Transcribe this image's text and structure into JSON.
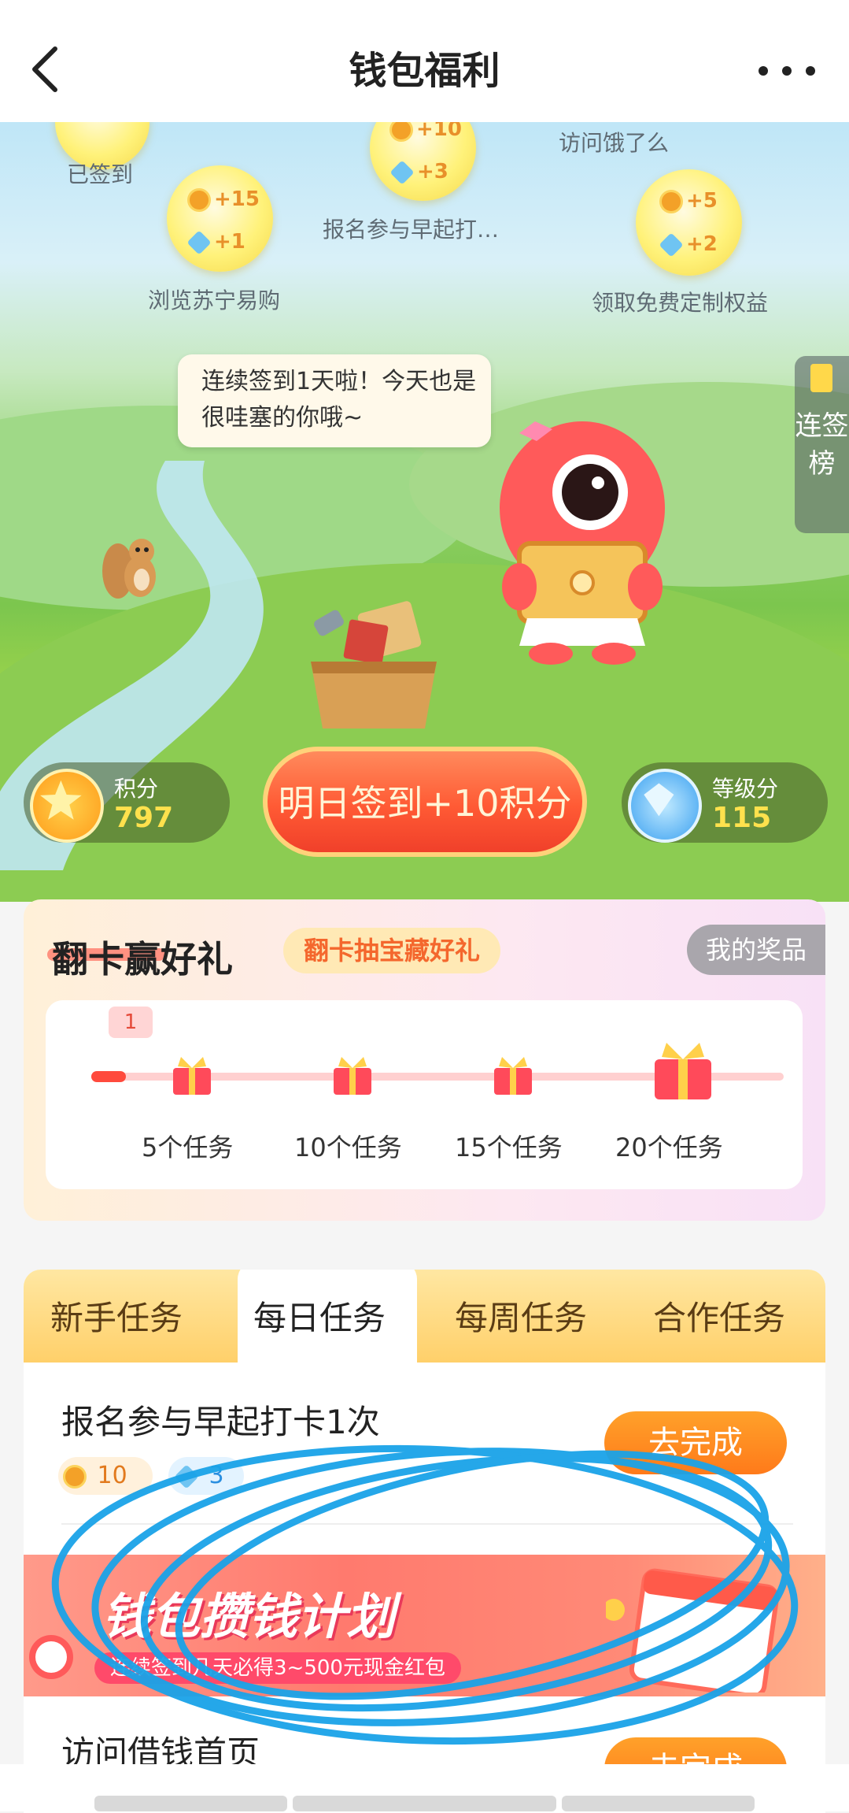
{
  "header": {
    "title": "钱包福利"
  },
  "hero": {
    "bubbles": [
      {
        "label": "已签到"
      },
      {
        "label": "浏览苏宁易购",
        "points": "+15",
        "level": "+1"
      },
      {
        "label": "报名参与早起打…",
        "points": "+10",
        "level": "+3"
      },
      {
        "label": "访问饿了么"
      },
      {
        "label": "领取免费定制权益",
        "points": "+5",
        "level": "+2"
      }
    ],
    "speech": "连续签到1天啦！今天也是很哇塞的你哦~",
    "rank_tab": "连签榜",
    "points": {
      "label": "积分",
      "value": "797"
    },
    "level": {
      "label": "等级分",
      "value": "115"
    },
    "signin_button": "明日签到+10积分"
  },
  "card": {
    "title": "翻卡赢好礼",
    "tag": "翻卡抽宝藏好礼",
    "my_prize": "我的奖品",
    "count": "1",
    "progress": 0.05,
    "milestones": [
      "5个任务",
      "10个任务",
      "15个任务",
      "20个任务"
    ]
  },
  "tasks": {
    "tabs": [
      "新手任务",
      "每日任务",
      "每周任务",
      "合作任务"
    ],
    "active_tab": "每日任务",
    "items": [
      {
        "title": "报名参与早起打卡1次",
        "points": "10",
        "level": "3",
        "button": "去完成"
      },
      {
        "title": "访问借钱首页",
        "button": "去完成"
      }
    ],
    "banner": {
      "title": "钱包攒钱计划",
      "subtitle": "连续签到几天必得3~500元现金红包"
    }
  },
  "colors": {
    "accent": "#ff5a34",
    "tab_bg": "#ffd06a",
    "scribble": "#1aa3e8"
  }
}
